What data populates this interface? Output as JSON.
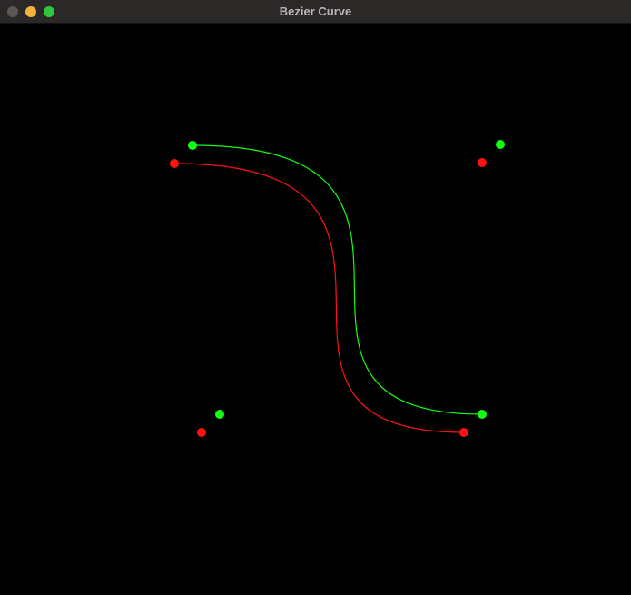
{
  "window": {
    "title": "Bezier Curve",
    "controls": [
      "close-icon",
      "minimize-icon",
      "maximize-icon"
    ],
    "colors": {
      "titlebar": "#2b2828",
      "close": "#5a5656",
      "minimize": "#f4b13b",
      "maximize": "#2fc63d",
      "canvas_background": "#000000"
    }
  },
  "curves": [
    {
      "color": "#11ff11"
    },
    {
      "color": "#ff1111"
    }
  ]
}
